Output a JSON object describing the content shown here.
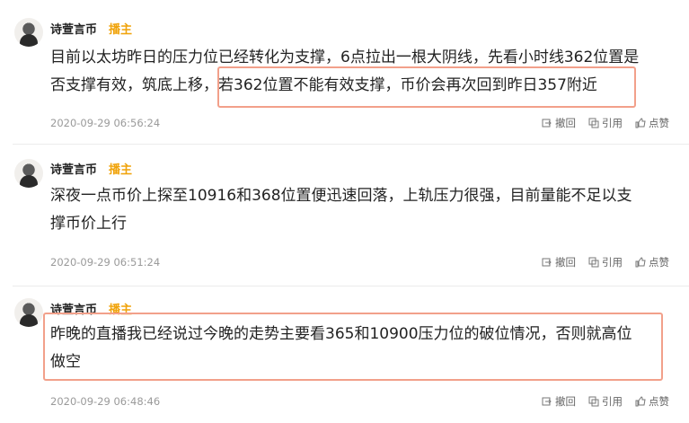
{
  "posts": [
    {
      "author": "诗萱言币",
      "role": "播主",
      "text_line1": "目前以太坊昨日的压力位已经转化为支撑，6点拉出一根大阴线，先看小时线362位置是",
      "text_line2": "否支撑有效，筑底上移，若362位置不能有效支撑，币价会再次回到昨日357附近",
      "timestamp": "2020-09-29 06:56:24",
      "actions": {
        "withdraw": "撤回",
        "quote": "引用",
        "like": "点赞"
      }
    },
    {
      "author": "诗萱言币",
      "role": "播主",
      "text_line1": "深夜一点币价上探至10916和368位置便迅速回落，上轨压力很强，目前量能不足以支",
      "text_line2": "撑币价上行",
      "timestamp": "2020-09-29 06:51:24",
      "actions": {
        "withdraw": "撤回",
        "quote": "引用",
        "like": "点赞"
      }
    },
    {
      "author": "诗萱言币",
      "role": "播主",
      "text_line1": "昨晚的直播我已经说过今晚的走势主要看365和10900压力位的破位情况，否则就高位",
      "text_line2": "做空",
      "timestamp": "2020-09-29 06:48:46",
      "actions": {
        "withdraw": "撤回",
        "quote": "引用",
        "like": "点赞"
      }
    }
  ],
  "colors": {
    "role": "#f0a30a",
    "highlight": "#f2a08a",
    "meta": "#9a9a9a"
  },
  "icons": [
    "avatar",
    "withdraw-icon",
    "quote-icon",
    "like-icon"
  ]
}
